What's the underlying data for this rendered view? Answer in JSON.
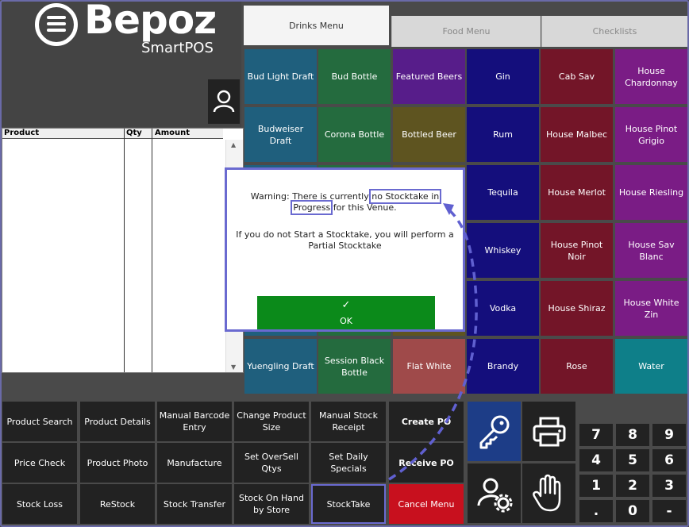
{
  "brand": {
    "name": "Bepoz",
    "sub": "SmartPOS"
  },
  "icons": {
    "menu": "hamburger-icon",
    "user": "user-icon",
    "key": "key-icon",
    "printer": "printer-icon",
    "hand": "hand-icon",
    "user_settings": "user-settings-icon"
  },
  "grid": {
    "columns": [
      "Product",
      "Qty",
      "Amount"
    ]
  },
  "tabs": [
    "Drinks Menu",
    "Food Menu",
    "Checklists"
  ],
  "tiles": [
    [
      "Bud Light Draft",
      "Bud Bottle",
      "Featured Beers",
      "Gin",
      "Cab Sav",
      "House Chardonnay"
    ],
    [
      "Budweiser Draft",
      "Corona Bottle",
      "Bottled Beer",
      "Rum",
      "House Malbec",
      "House Pinot Grigio"
    ],
    [
      "",
      "",
      "",
      "Tequila",
      "House Merlot",
      "House Riesling"
    ],
    [
      "",
      "",
      "",
      "Whiskey",
      "House Pinot Noir",
      "House Sav Blanc"
    ],
    [
      "",
      "",
      "",
      "Vodka",
      "House Shiraz",
      "House White Zin"
    ],
    [
      "Yuengling Draft",
      "Session Black Bottle",
      "Flat White",
      "Brandy",
      "Rose",
      "Water"
    ]
  ],
  "buttons": [
    [
      "Product Search",
      "Product Details",
      "Manual Barcode Entry",
      "Change Product Size",
      "Manual Stock Receipt",
      "Create PO"
    ],
    [
      "Price Check",
      "Product Photo",
      "Manufacture",
      "Set OverSell Qtys",
      "Set Daily Specials",
      "Receive PO"
    ],
    [
      "Stock Loss",
      "ReStock",
      "Stock Transfer",
      "Stock On Hand by Store",
      "StockTake",
      "Cancel Menu"
    ]
  ],
  "numpad": [
    "7",
    "8",
    "9",
    "4",
    "5",
    "6",
    "1",
    "2",
    "3",
    ".",
    "0",
    "-"
  ],
  "dialog": {
    "warn_prefix": "Warning: There is currently ",
    "warn_highlight": "no Stocktake in Progress",
    "warn_suffix": " for this Venue.",
    "message": "If you do not Start a Stocktake, you will perform a Partial Stocktake",
    "ok_check": "✓",
    "ok_label": "OK"
  }
}
